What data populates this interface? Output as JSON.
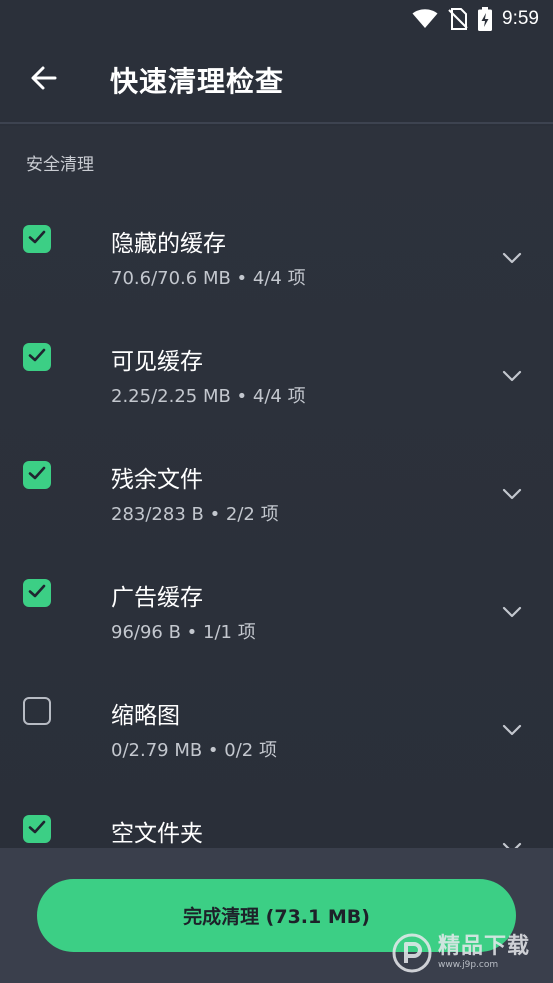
{
  "status_bar": {
    "time": "9:59",
    "icons": [
      "wifi-icon",
      "no-sim-icon",
      "battery-charging-icon"
    ]
  },
  "header": {
    "title": "快速清理检查",
    "back_icon": "arrow-left-icon"
  },
  "section": {
    "title": "安全清理"
  },
  "items": [
    {
      "title": "隐藏的缓存",
      "detail": "70.6/70.6 MB • 4/4 项",
      "checked": true
    },
    {
      "title": "可见缓存",
      "detail": "2.25/2.25 MB • 4/4 项",
      "checked": true
    },
    {
      "title": "残余文件",
      "detail": "283/283 B • 2/2 项",
      "checked": true
    },
    {
      "title": "广告缓存",
      "detail": "96/96 B • 1/1 项",
      "checked": true
    },
    {
      "title": "缩略图",
      "detail": "0/2.79 MB • 0/2 项",
      "checked": false
    },
    {
      "title": "空文件夹",
      "detail": "",
      "checked": true
    }
  ],
  "footer": {
    "button_label": "完成清理 (73.1 MB)"
  },
  "watermark": {
    "text": "精品下载",
    "url": "www.j9p.com"
  },
  "colors": {
    "accent": "#3ccf85",
    "background": "#2b303a",
    "bottom_bar": "#3a3f4c"
  }
}
